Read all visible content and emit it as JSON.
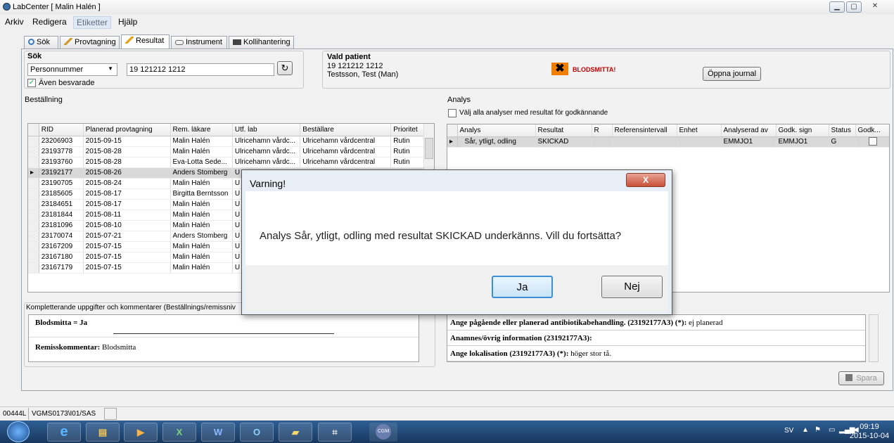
{
  "window": {
    "title": "LabCenter [ Malin Halén ]"
  },
  "menu": [
    "Arkiv",
    "Redigera",
    "Etiketter",
    "Hjälp"
  ],
  "tabs": [
    "Sök",
    "Provtagning",
    "Resultat",
    "Instrument",
    "Kollihantering"
  ],
  "search": {
    "group_label": "Sök",
    "type_value": "Personnummer",
    "query_value": "19 121212 1212",
    "include_answered_label": "Även besvarade"
  },
  "patient": {
    "label": "Vald patient",
    "id": "19 121212 1212",
    "name": "Testsson, Test  (Man)",
    "warning": "BLODSMITTA!",
    "open_journal_label": "Öppna journal"
  },
  "orders": {
    "label": "Beställning",
    "columns": [
      "RID",
      "Planerad provtagning",
      "Rem. läkare",
      "Utf. lab",
      "Beställare",
      "Prioritet"
    ],
    "rows": [
      [
        "23206903",
        "2015-09-15",
        "Malin Halén",
        "Ulricehamn vårdc...",
        "Ulricehamn vårdcentral",
        "Rutin"
      ],
      [
        "23193778",
        "2015-08-28",
        "Malin Halén",
        "Ulricehamn vårdc...",
        "Ulricehamn vårdcentral",
        "Rutin"
      ],
      [
        "23193760",
        "2015-08-28",
        "Eva-Lotta Sede...",
        "Ulricehamn vårdc...",
        "Ulricehamn vårdcentral",
        "Rutin"
      ],
      [
        "23192177",
        "2015-08-26",
        "Anders Stomberg",
        "U",
        "",
        ""
      ],
      [
        "23190705",
        "2015-08-24",
        "Malin Halén",
        "U",
        "",
        ""
      ],
      [
        "23185605",
        "2015-08-17",
        "Birgitta Berntsson",
        "U",
        "",
        ""
      ],
      [
        "23184651",
        "2015-08-17",
        "Malin Halén",
        "U",
        "",
        ""
      ],
      [
        "23181844",
        "2015-08-11",
        "Malin Halén",
        "U",
        "",
        ""
      ],
      [
        "23181096",
        "2015-08-10",
        "Malin Halén",
        "U",
        "",
        ""
      ],
      [
        "23170074",
        "2015-07-21",
        "Anders Stomberg",
        "U",
        "",
        ""
      ],
      [
        "23167209",
        "2015-07-15",
        "Malin Halén",
        "U",
        "",
        ""
      ],
      [
        "23167180",
        "2015-07-15",
        "Malin Halén",
        "U",
        "",
        ""
      ],
      [
        "23167179",
        "2015-07-15",
        "Malin Halén",
        "U",
        "",
        ""
      ]
    ]
  },
  "comments": {
    "label": "Kompletterande uppgifter och kommentarer (Beställnings/remissniv",
    "line1": "Blodsmitta = Ja",
    "line2_label": "Remisskommentar:",
    "line2_value": "Blodsmitta"
  },
  "analysis": {
    "label": "Analys",
    "select_all_label": "Välj alla analyser med resultat för godkännande",
    "columns": [
      "Analys",
      "Resultat",
      "R",
      "Referensintervall",
      "Enhet",
      "Analyserad av",
      "Godk. sign",
      "Status",
      "Godk..."
    ],
    "rows": [
      [
        "Sår, ytligt, odling",
        "SKICKAD",
        "",
        "",
        "",
        "EMMJO1",
        "EMMJO1",
        "G",
        ""
      ]
    ],
    "notes": [
      {
        "label": "Ange pågående eller planerad antibiotikabehandling. (23192177A3) (*):",
        "value": "ej planerad"
      },
      {
        "label": "Anamnes/övrig information (23192177A3):",
        "value": ""
      },
      {
        "label": "Ange lokalisation (23192177A3) (*):",
        "value": "höger stor tå."
      }
    ],
    "save_label": "Spara"
  },
  "dialog": {
    "title": "Varning!",
    "close_label": "X",
    "message": "Analys Sår, ytligt, odling med resultat SKICKAD underkänns. Vill du fortsätta?",
    "yes_label": "Ja",
    "no_label": "Nej"
  },
  "status": {
    "code": "00444L",
    "path": "VGMS0173\\I01/SAS"
  },
  "taskbar": {
    "icons": [
      "start-orb-icon",
      "internet-explorer-icon",
      "file-explorer-icon",
      "media-player-icon",
      "excel-icon",
      "word-icon",
      "outlook-icon",
      "folder-icon",
      "network-icon",
      "cgm-icon"
    ],
    "lang": "SV",
    "time": "09:19",
    "date": "2015-10-04"
  }
}
